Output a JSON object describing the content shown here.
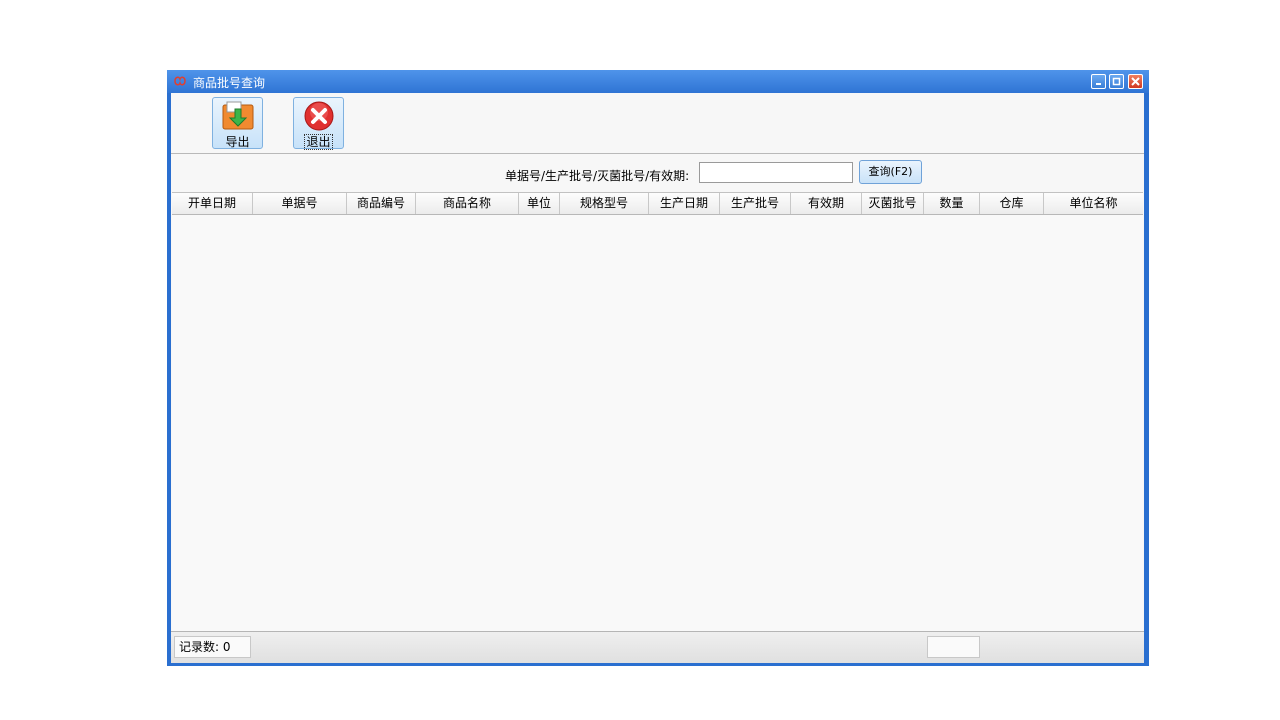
{
  "window": {
    "title": "商品批号查询"
  },
  "toolbar": {
    "export_label": "导出",
    "exit_label": "退出"
  },
  "search": {
    "label": "单据号/生产批号/灭菌批号/有效期:",
    "value": "",
    "button_label": "查询(F2)"
  },
  "table": {
    "columns": [
      "开单日期",
      "单据号",
      "商品编号",
      "商品名称",
      "单位",
      "规格型号",
      "生产日期",
      "生产批号",
      "有效期",
      "灭菌批号",
      "数量",
      "仓库",
      "单位名称"
    ],
    "rows": []
  },
  "status": {
    "record_count_label": "记录数:",
    "record_count": "0",
    "record_count_text": "记录数: 0"
  },
  "colors": {
    "titlebar": "#2f74d4",
    "button_bg": "#c7e2f9",
    "exit_icon": "#e03030",
    "export_icon": "#f08a30"
  }
}
